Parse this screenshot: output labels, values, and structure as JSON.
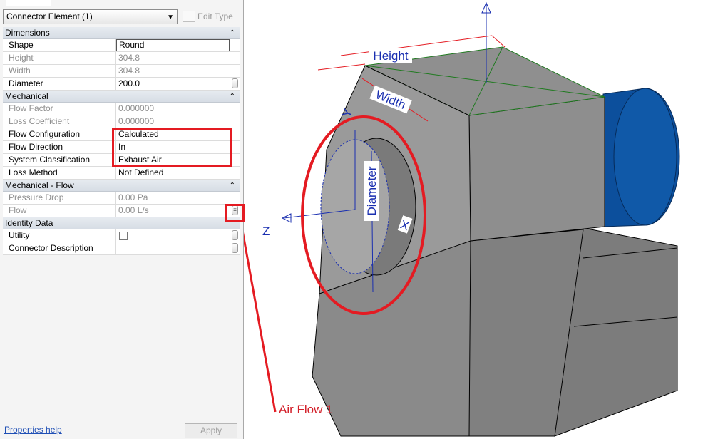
{
  "type_selector": {
    "value": "Connector Element (1)"
  },
  "edit_type_label": "Edit Type",
  "groups": [
    {
      "label": "Dimensions",
      "rows": [
        {
          "key": "Shape",
          "value": "Round"
        },
        {
          "key": "Height",
          "value": "304.8"
        },
        {
          "key": "Width",
          "value": "304.8"
        },
        {
          "key": "Diameter",
          "value": "200.0"
        }
      ]
    },
    {
      "label": "Mechanical",
      "rows": [
        {
          "key": "Flow Factor",
          "value": "0.000000"
        },
        {
          "key": "Loss Coefficient",
          "value": "0.000000"
        },
        {
          "key": "Flow Configuration",
          "value": "Calculated"
        },
        {
          "key": "Flow Direction",
          "value": "In"
        },
        {
          "key": "System Classification",
          "value": "Exhaust Air"
        },
        {
          "key": "Loss Method",
          "value": "Not Defined"
        }
      ]
    },
    {
      "label": "Mechanical - Flow",
      "rows": [
        {
          "key": "Pressure Drop",
          "value": "0.00 Pa"
        },
        {
          "key": "Flow",
          "value": "0.00 L/s"
        }
      ]
    },
    {
      "label": "Identity Data",
      "rows": [
        {
          "key": "Utility",
          "value": ""
        },
        {
          "key": "Connector Description",
          "value": ""
        }
      ]
    }
  ],
  "footer": {
    "help_link": "Properties help",
    "apply_label": "Apply"
  },
  "viewport": {
    "labels": {
      "height": "Height",
      "width": "Width",
      "diameter": "Diameter",
      "axis_x": "X",
      "axis_y": "Y",
      "axis_z": "Z"
    },
    "annotation": "Air Flow 1"
  },
  "colors": {
    "highlight": "#e41b22",
    "dimension": "#e41b22",
    "axis": "#1a2fb0",
    "body": "#8f8f8f",
    "fan_motor": "#0c4f9c"
  }
}
